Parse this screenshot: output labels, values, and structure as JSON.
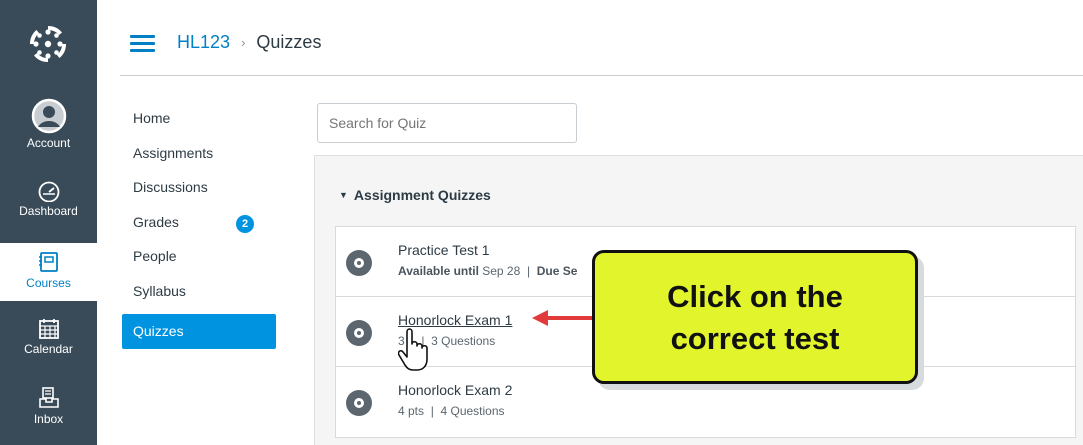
{
  "global_nav": {
    "items": [
      {
        "label": "Account",
        "icon": "account-icon"
      },
      {
        "label": "Dashboard",
        "icon": "dashboard-icon"
      },
      {
        "label": "Courses",
        "icon": "courses-icon"
      },
      {
        "label": "Calendar",
        "icon": "calendar-icon"
      },
      {
        "label": "Inbox",
        "icon": "inbox-icon"
      }
    ],
    "background": "#394b58",
    "active_color": "#0081c6"
  },
  "header": {
    "course": "HL123",
    "separator": "›",
    "page": "Quizzes"
  },
  "course_nav": {
    "items": [
      {
        "label": "Home"
      },
      {
        "label": "Assignments"
      },
      {
        "label": "Discussions"
      },
      {
        "label": "Grades",
        "badge": "2"
      },
      {
        "label": "People"
      },
      {
        "label": "Syllabus"
      },
      {
        "label": "Quizzes",
        "active": true
      }
    ]
  },
  "search": {
    "placeholder": "Search for Quiz"
  },
  "quiz_group": {
    "title": "Assignment Quizzes",
    "quizzes": [
      {
        "title": "Practice Test 1",
        "available_label": "Available until",
        "available_date": "Sep 28",
        "sep": "|",
        "due_label": "Due Se"
      },
      {
        "title": "Honorlock Exam 1",
        "pts": "3",
        "sep": "|",
        "questions": "3 Questions"
      },
      {
        "title": "Honorlock Exam 2",
        "pts": "4 pts",
        "sep": "|",
        "questions": "4 Questions"
      }
    ]
  },
  "annotation": {
    "line1": "Click on the",
    "line2": "correct test",
    "fill": "#e2f52c",
    "arrow_color": "#e03a3a"
  }
}
